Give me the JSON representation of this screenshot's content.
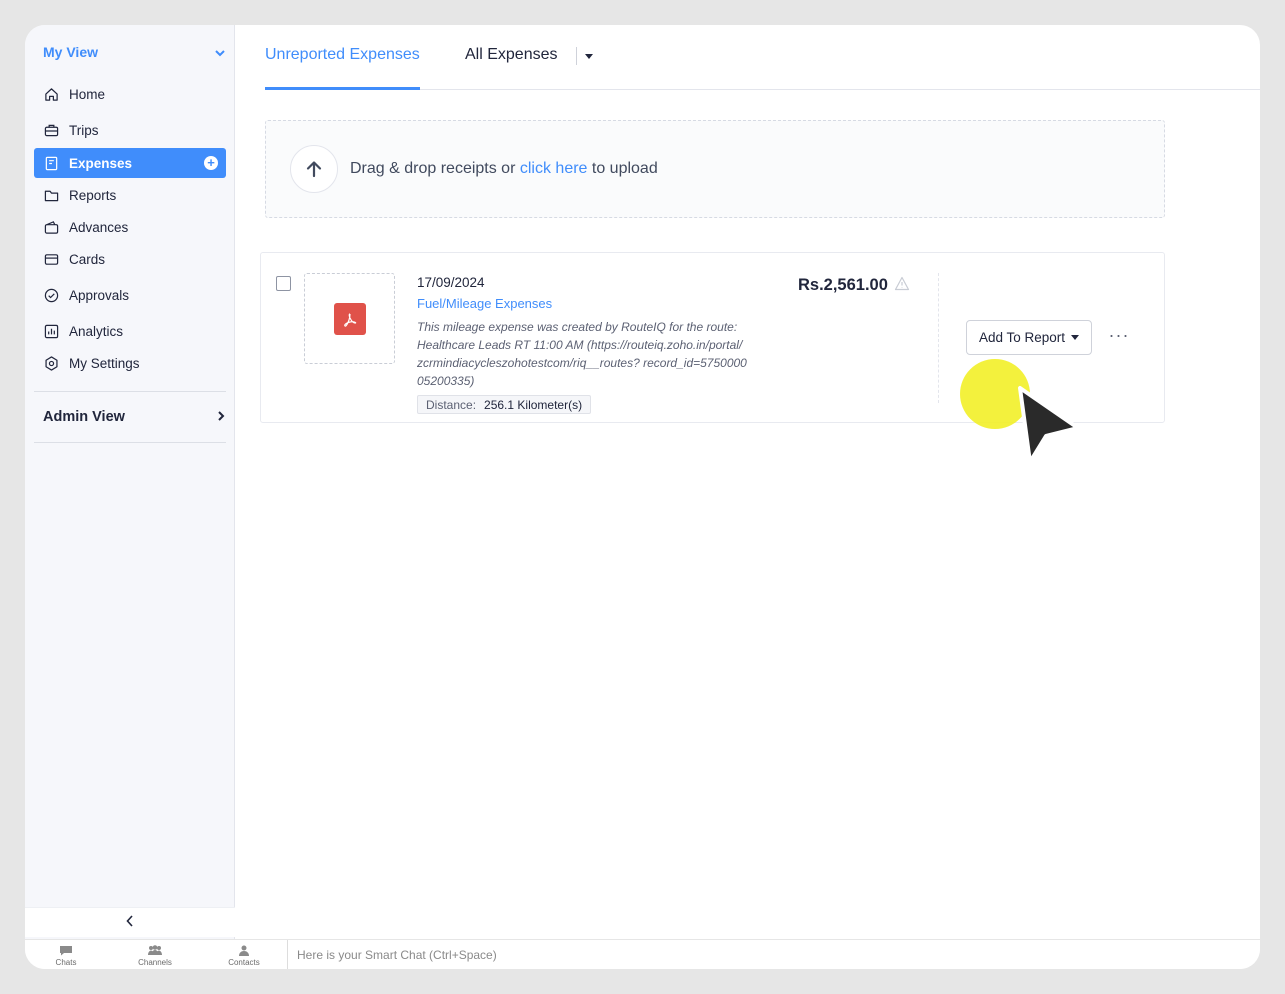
{
  "sidebar": {
    "my_view_label": "My View",
    "items": [
      {
        "label": "Home",
        "icon": "home-icon"
      },
      {
        "label": "Trips",
        "icon": "trips-icon"
      },
      {
        "label": "Expenses",
        "icon": "expenses-icon",
        "active": true
      },
      {
        "label": "Reports",
        "icon": "folder-icon"
      },
      {
        "label": "Advances",
        "icon": "wallet-icon"
      },
      {
        "label": "Cards",
        "icon": "card-icon"
      },
      {
        "label": "Approvals",
        "icon": "check-circle-icon"
      },
      {
        "label": "Analytics",
        "icon": "analytics-icon"
      },
      {
        "label": "My Settings",
        "icon": "settings-icon"
      }
    ],
    "admin_view_label": "Admin View"
  },
  "bottombar": {
    "chats": "Chats",
    "channels": "Channels",
    "contacts": "Contacts",
    "smart_chat_placeholder": "Here is your Smart Chat (Ctrl+Space)"
  },
  "tabs": {
    "unreported": "Unreported Expenses",
    "all": "All Expenses"
  },
  "upload": {
    "text_before": "Drag & drop receipts or",
    "link": "click here",
    "text_after": "to upload"
  },
  "expense": {
    "date": "17/09/2024",
    "category": "Fuel/Mileage Expenses",
    "description": "This mileage expense was created by RouteIQ for the route: Healthcare Leads RT 11:00 AM (https://routeiq.zoho.in/portal/zcrmindiacycleszohotestcom/riq__routes? record_id=575000005200335)",
    "distance_label": "Distance:",
    "distance_value": "256.1 Kilometer(s)",
    "amount": "Rs.2,561.00",
    "add_to_report_label": "Add To Report",
    "more_label": "···"
  },
  "colors": {
    "accent": "#408dfb",
    "pdf_red": "#e0524a",
    "cursor_highlight": "#f2f028"
  }
}
